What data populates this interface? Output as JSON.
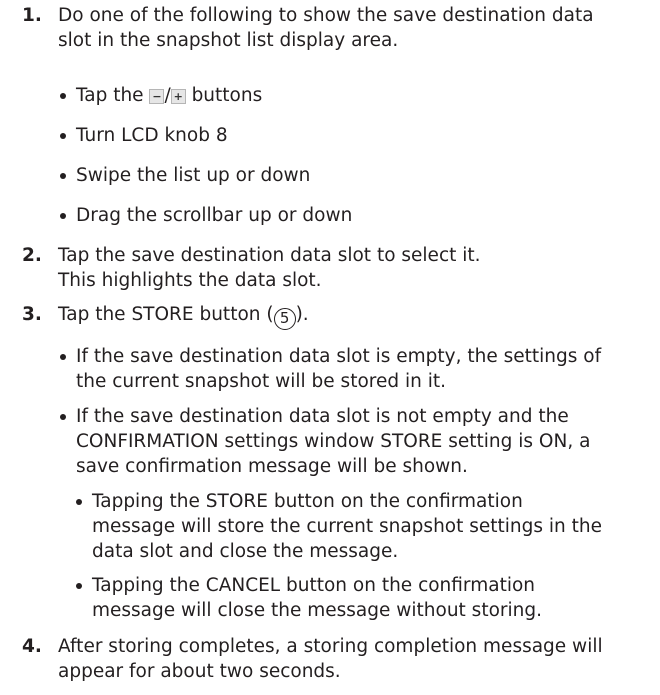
{
  "steps": [
    {
      "number": "1.",
      "lines": [
        "Do one of the following to show the save destination data",
        "slot in the snapshot list display area."
      ],
      "bullets": [
        {
          "before": "Tap the ",
          "minus_icon": "−",
          "slash": "/",
          "plus_icon": "+",
          "after": " buttons"
        },
        {
          "text": "Turn LCD knob 8"
        },
        {
          "text": "Swipe the list up or down"
        },
        {
          "text": "Drag the scrollbar up or down"
        }
      ]
    },
    {
      "number": "2.",
      "lines": [
        "Tap the save destination data slot to select it.",
        "This highlights the data slot."
      ]
    },
    {
      "number": "3.",
      "text_before": "Tap the STORE button (",
      "circled_number": "5",
      "text_after": ").",
      "bullets": [
        {
          "lines": [
            "If the save destination data slot is empty, the settings of",
            "the current snapshot will be stored in it."
          ]
        },
        {
          "lines": [
            "If the save destination data slot is not empty and the",
            "CONFIRMATION settings window STORE setting is ON, a",
            "save confirmation message will be shown."
          ]
        }
      ],
      "sub_bullets": [
        {
          "lines": [
            "Tapping the STORE button on the confirmation",
            "message will store the current snapshot settings in the",
            "data slot and close the message."
          ]
        },
        {
          "lines": [
            "Tapping the CANCEL button on the confirmation",
            "message will close the message without storing."
          ]
        }
      ]
    },
    {
      "number": "4.",
      "lines": [
        "After storing completes, a storing completion message will",
        "appear for about two seconds."
      ]
    }
  ]
}
